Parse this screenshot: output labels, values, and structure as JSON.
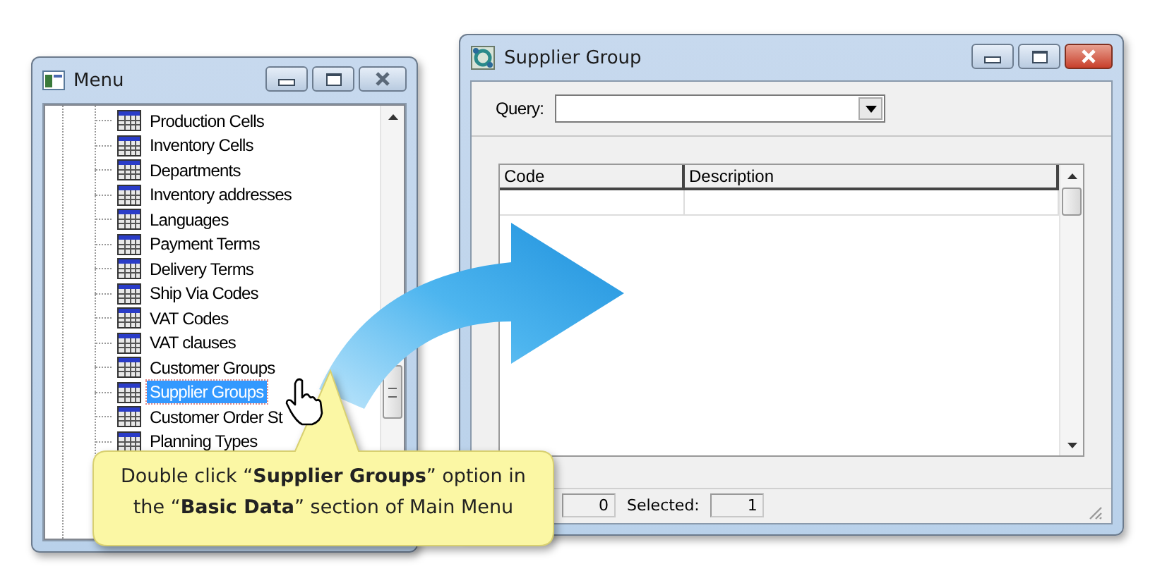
{
  "menu_window": {
    "title": "Menu",
    "active": false,
    "items": [
      {
        "label": "Production Cells",
        "selected": false
      },
      {
        "label": "Inventory Cells",
        "selected": false
      },
      {
        "label": "Departments",
        "selected": false
      },
      {
        "label": "Inventory addresses",
        "selected": false
      },
      {
        "label": "Languages",
        "selected": false
      },
      {
        "label": "Payment Terms",
        "selected": false
      },
      {
        "label": "Delivery Terms",
        "selected": false
      },
      {
        "label": "Ship Via Codes",
        "selected": false
      },
      {
        "label": "VAT Codes",
        "selected": false
      },
      {
        "label": "VAT clauses",
        "selected": false
      },
      {
        "label": "Customer Groups",
        "selected": false
      },
      {
        "label": "Supplier Groups",
        "selected": true
      },
      {
        "label": "Customer Order St",
        "selected": false
      },
      {
        "label": "Planning Types",
        "selected": false
      }
    ]
  },
  "supplier_window": {
    "title": "Supplier Group",
    "active": true,
    "query_label": "Query:",
    "columns": [
      "Code",
      "Description"
    ],
    "status": {
      "count": "0",
      "selected_label": "Selected:",
      "selected_count": "1"
    }
  },
  "callout": "Double click “**Supplier Groups**” option in the “**Basic Data**” section of Main Menu"
}
